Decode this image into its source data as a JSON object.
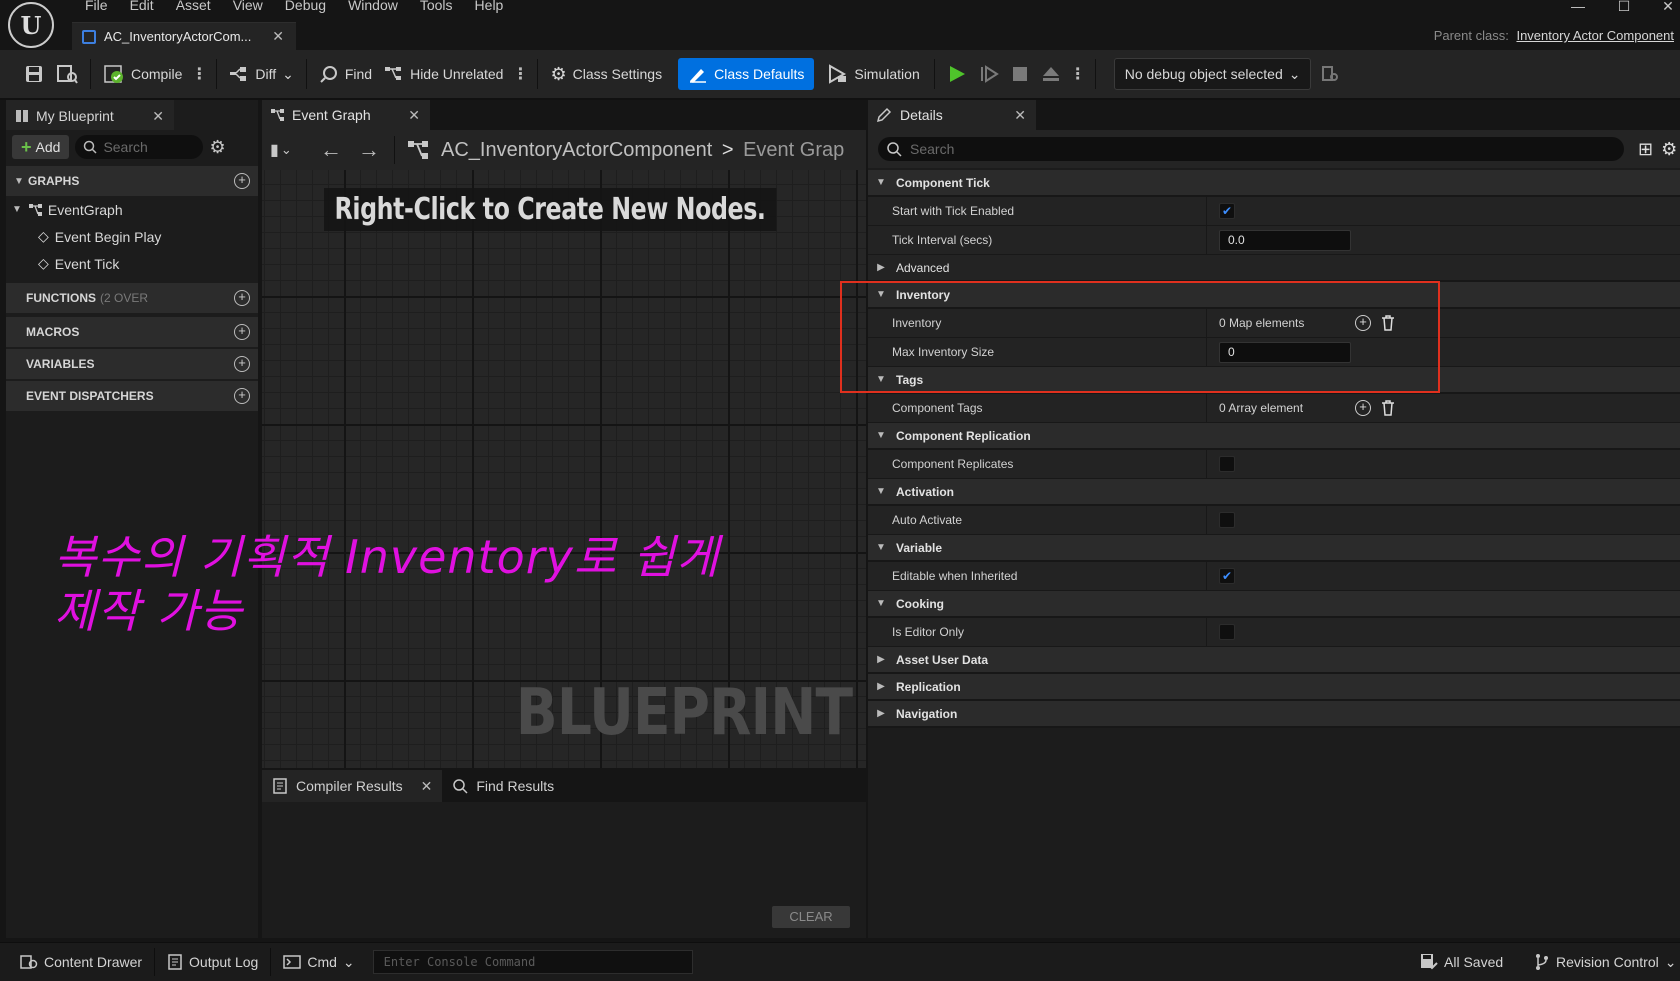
{
  "app": {
    "logo_text": "U",
    "menu": [
      "File",
      "Edit",
      "Asset",
      "View",
      "Debug",
      "Window",
      "Tools",
      "Help"
    ],
    "document_tab": "AC_InventoryActorCom...",
    "parent_class_label": "Parent class:",
    "parent_class_value": "Inventory Actor Component"
  },
  "toolbar": {
    "compile": "Compile",
    "diff": "Diff",
    "find": "Find",
    "hide_unrelated": "Hide Unrelated",
    "class_settings": "Class Settings",
    "class_defaults": "Class Defaults",
    "simulation": "Simulation",
    "debug_object": "No debug object selected"
  },
  "my_blueprint": {
    "tab": "My Blueprint",
    "add": "Add",
    "search_placeholder": "Search",
    "graphs_header": "GRAPHS",
    "event_graph": "EventGraph",
    "events": [
      "Event Begin Play",
      "Event Tick"
    ],
    "functions_header": "FUNCTIONS",
    "functions_note": "(2 OVER",
    "macros_header": "MACROS",
    "variables_header": "VARIABLES",
    "dispatchers_header": "EVENT DISPATCHERS"
  },
  "graph": {
    "tab": "Event Graph",
    "breadcrumb_asset": "AC_InventoryActorComponent",
    "breadcrumb_sep": ">",
    "breadcrumb_graph": "Event Grap",
    "hint": "Right-Click to Create New Nodes.",
    "watermark": "BLUEPRINT"
  },
  "compiler": {
    "tab_compiler": "Compiler Results",
    "tab_find": "Find Results",
    "clear": "CLEAR"
  },
  "annotation": {
    "line1": "복수의 기획적 Inventory로 쉽게",
    "line2": "제작 가능",
    "color": "#e010e0"
  },
  "details": {
    "tab": "Details",
    "search_placeholder": "Search",
    "sections": {
      "component_tick": "Component Tick",
      "start_tick": "Start with Tick Enabled",
      "start_tick_checked": true,
      "tick_interval": "Tick Interval (secs)",
      "tick_interval_value": "0.0",
      "advanced": "Advanced",
      "inventory_header": "Inventory",
      "inventory_label": "Inventory",
      "inventory_value": "0 Map elements",
      "max_inventory": "Max Inventory Size",
      "max_inventory_value": "0",
      "tags": "Tags",
      "component_tags": "Component Tags",
      "component_tags_value": "0 Array element",
      "component_replication": "Component Replication",
      "component_replicates": "Component Replicates",
      "activation": "Activation",
      "auto_activate": "Auto Activate",
      "variable": "Variable",
      "editable_inherited": "Editable when Inherited",
      "editable_inherited_checked": true,
      "cooking": "Cooking",
      "is_editor_only": "Is Editor Only",
      "asset_user_data": "Asset User Data",
      "replication": "Replication",
      "navigation": "Navigation"
    },
    "highlight_color": "#e0301e"
  },
  "statusbar": {
    "content_drawer": "Content Drawer",
    "output_log": "Output Log",
    "cmd": "Cmd",
    "console_placeholder": "Enter Console Command",
    "all_saved": "All Saved",
    "revision_control": "Revision Control"
  }
}
